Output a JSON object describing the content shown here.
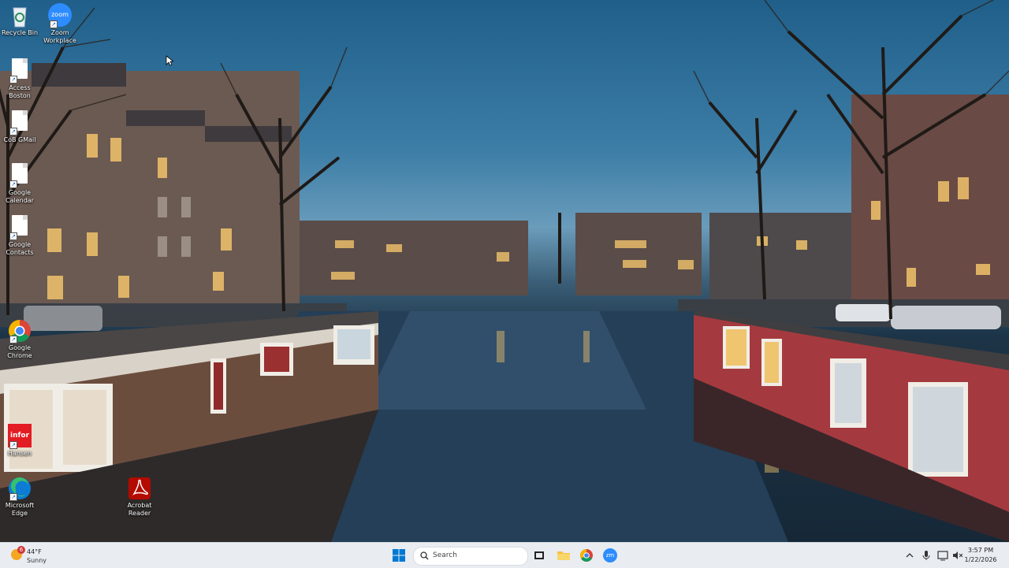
{
  "desktop_icons": [
    {
      "label": "Recycle Bin",
      "icon": "recycle-bin-icon"
    },
    {
      "label": "Zoom\nWorkplace",
      "icon": "zoom-icon",
      "brand_text": "zoom"
    },
    {
      "label": "Access\nBoston",
      "icon": "document-icon"
    },
    {
      "label": "CoB GMail",
      "icon": "document-icon"
    },
    {
      "label": "Google\nCalendar",
      "icon": "document-icon"
    },
    {
      "label": "Google\nContacts",
      "icon": "document-icon"
    },
    {
      "label": "Google\nChrome",
      "icon": "chrome-icon"
    },
    {
      "label": "Hansen",
      "icon": "infor-icon",
      "brand_text": "infor"
    },
    {
      "label": "Microsoft\nEdge",
      "icon": "edge-icon"
    },
    {
      "label": "Acrobat\nReader",
      "icon": "acrobat-icon"
    }
  ],
  "taskbar": {
    "weather": {
      "temp": "44°F",
      "condition": "Sunny",
      "badge": "6"
    },
    "search_placeholder": "Search",
    "pinned": [
      "windows-start-icon",
      "task-view-icon",
      "file-explorer-icon",
      "chrome-icon",
      "zoom-icon"
    ],
    "zoom_text": "zm",
    "tray": [
      "chevron-up-icon",
      "microphone-icon",
      "display-icon",
      "volume-muted-icon"
    ],
    "clock": {
      "time": "3:57 PM",
      "date": "1/22/2026"
    }
  },
  "colors": {
    "taskbar_bg": "#e9edf2",
    "accent": "#0067c0",
    "zoom_blue": "#2d8cff",
    "infor_red": "#e31b23",
    "acrobat_red": "#b30b00"
  }
}
